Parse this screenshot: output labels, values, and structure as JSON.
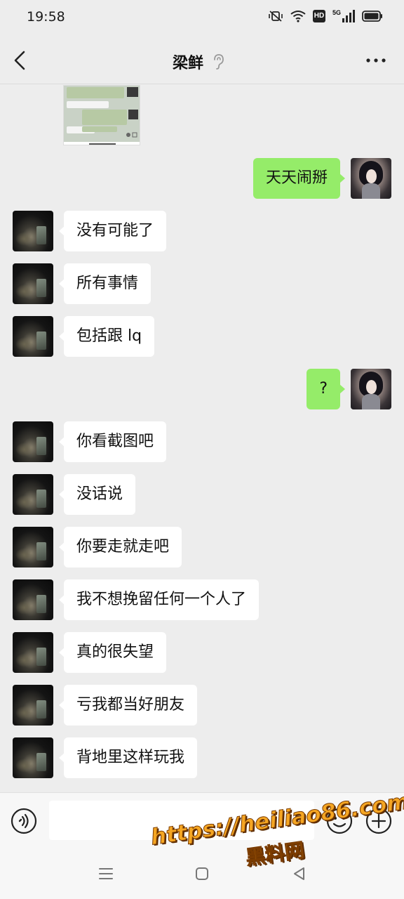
{
  "status_bar": {
    "time": "19:58",
    "icons": [
      "vibrate-mute-icon",
      "wifi-icon",
      "hd-icon",
      "5g-signal-icon",
      "battery-icon"
    ],
    "hd_label": "HD",
    "network_label": "5G"
  },
  "header": {
    "title": "梁鲜",
    "icons": [
      "back-icon",
      "ear-icon",
      "more-icon"
    ]
  },
  "messages": [
    {
      "side": "left",
      "text": "没有可能了"
    },
    {
      "side": "left",
      "text": "所有事情"
    },
    {
      "side": "left",
      "text": "包括跟 lq"
    },
    {
      "side": "right",
      "text": "?"
    },
    {
      "side": "left",
      "text": "你看截图吧"
    },
    {
      "side": "left",
      "text": "没话说"
    },
    {
      "side": "left",
      "text": "你要走就走吧"
    },
    {
      "side": "left",
      "text": "我不想挽留任何一个人了"
    },
    {
      "side": "left",
      "text": "真的很失望"
    },
    {
      "side": "left",
      "text": "亏我都当好朋友"
    },
    {
      "side": "left",
      "text": "背地里这样玩我"
    }
  ],
  "first_right_message": {
    "side": "right",
    "text": "天天闹掰"
  },
  "input_bar": {
    "placeholder": "",
    "icons": [
      "voice-icon",
      "emoji-icon",
      "plus-icon"
    ]
  },
  "nav_bar": {
    "icons": [
      "menu-icon",
      "home-icon",
      "back-triangle-icon"
    ]
  },
  "watermark": {
    "url": "https://heiliao86.com",
    "name": "黑料网"
  },
  "colors": {
    "background": "#ededed",
    "bubble_right": "#95ec69",
    "bubble_left": "#ffffff"
  }
}
